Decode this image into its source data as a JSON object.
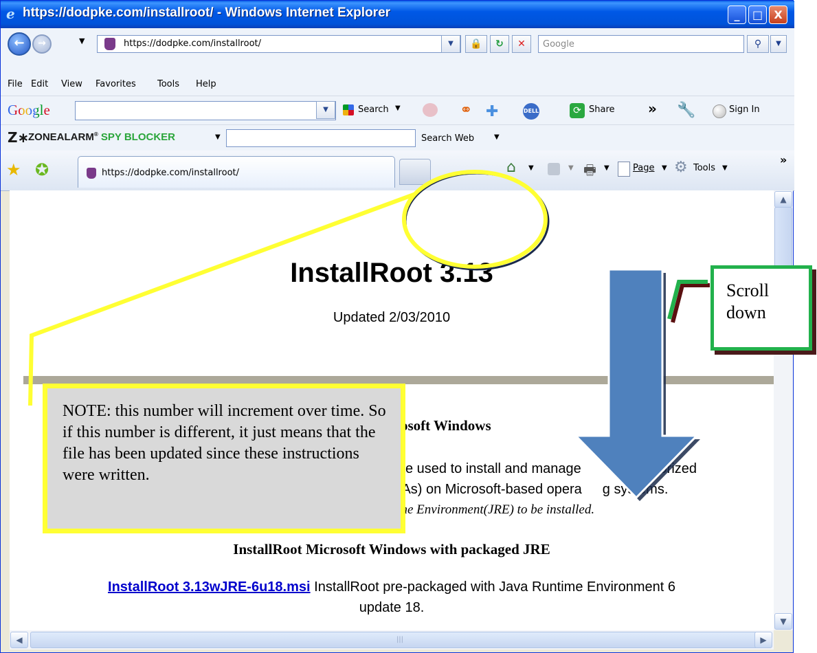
{
  "window": {
    "title": "https://dodpke.com/installroot/ - Windows Internet Explorer",
    "minimize": "_",
    "maximize": "□",
    "close": "X"
  },
  "nav": {
    "address": "https://dodpke.com/installroot/",
    "search_placeholder": "Google"
  },
  "menu": [
    "File",
    "Edit",
    "View",
    "Favorites",
    "Tools",
    "Help"
  ],
  "google_toolbar": {
    "logo": "Google",
    "search_label": "Search",
    "share_label": "Share",
    "more_label": "»",
    "signin_label": "Sign In"
  },
  "zonealarm": {
    "brand": "ZoneAlarm",
    "product": "Spy Blocker",
    "search_web_label": "Search Web"
  },
  "tabs": {
    "active_tab_title": "https://dodpke.com/installroot/",
    "page_menu": "Page",
    "tools_menu": "Tools",
    "more": "»"
  },
  "page": {
    "heading": "InstallRoot 3.13",
    "updated": "Updated 2/03/2010",
    "section1_partial": "rosoft Windows",
    "desc_line1": "e used to install and manage",
    "desc_line1_tail": "uthorized",
    "desc_line2": "CAs) on Microsoft-based opera",
    "desc_line2_tail": "g systems.",
    "desc_line3": "ime Environment(JRE) to be installed.",
    "section2": "InstallRoot Microsoft Windows with packaged JRE",
    "download_link": "InstallRoot 3.13wJRE-6u18.msi",
    "download_desc": "InstallRoot pre-packaged with Java Runtime Environment 6",
    "download_desc2": "update 18."
  },
  "annotations": {
    "note": "NOTE:  this number will increment over time.  So if this number is different, it just means that the file has been updated since these instructions were written.",
    "scroll_hint": "Scroll down",
    "highlight_color": "#ffff33",
    "arrow_color": "#4f81bd",
    "callout_color": "#22b14c"
  }
}
